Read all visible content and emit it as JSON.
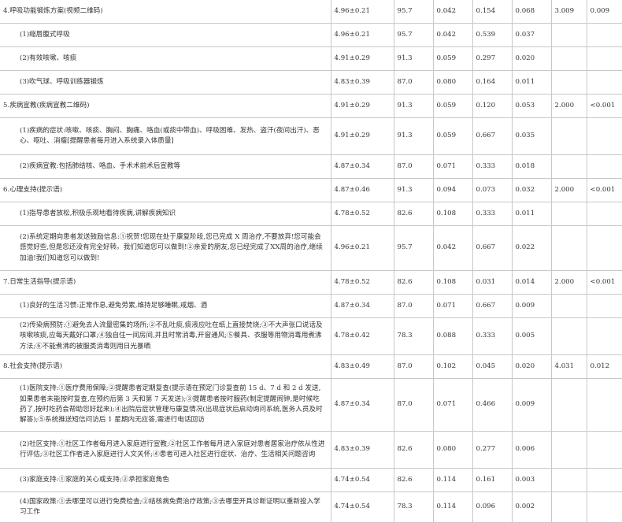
{
  "rows": [
    {
      "item": "4.呼吸功能锻炼方案(视频二维码)",
      "sub": false,
      "h": 1,
      "v": [
        "4.96±0.21",
        "95.7",
        "0.042",
        "0.154",
        "0.068",
        "3.009",
        "0.009"
      ]
    },
    {
      "item": "(1)缩唇腹式呼吸",
      "sub": true,
      "h": 1,
      "v": [
        "4.96±0.21",
        "95.7",
        "0.042",
        "0.539",
        "0.037",
        "",
        ""
      ]
    },
    {
      "item": "(2)有效咳嗽、咳痰",
      "sub": true,
      "h": 1,
      "v": [
        "4.91±0.29",
        "91.3",
        "0.059",
        "0.297",
        "0.020",
        "",
        ""
      ]
    },
    {
      "item": "(3)吹气球、呼吸训练器锻炼",
      "sub": true,
      "h": 1,
      "v": [
        "4.83±0.39",
        "87.0",
        "0.080",
        "0.164",
        "0.011",
        "",
        ""
      ]
    },
    {
      "item": "5.疾病宣教(疾病宣教二维码)",
      "sub": false,
      "h": 1,
      "v": [
        "4.91±0.29",
        "91.3",
        "0.059",
        "0.120",
        "0.053",
        "2.000",
        "<0.001"
      ]
    },
    {
      "item": "(1)疾病的症状:咳嗽、咳痰、胸闷、胸痛、咯血(或痰中带血)、呼吸困难、发热、盗汗(夜间出汗)、恶心、呕吐、消瘦[提醒患者每月进入系统录入体质量]",
      "sub": true,
      "h": 3,
      "v": [
        "4.91±0.29",
        "91.3",
        "0.059",
        "0.667",
        "0.035",
        "",
        ""
      ]
    },
    {
      "item": "(2)疾病宣教:包括肺结核、咯血、手术术前术后宣教等",
      "sub": true,
      "h": 1,
      "v": [
        "4.87±0.34",
        "87.0",
        "0.071",
        "0.333",
        "0.018",
        "",
        ""
      ]
    },
    {
      "item": "6.心理支持(提示语)",
      "sub": false,
      "h": 1,
      "v": [
        "4.87±0.46",
        "91.3",
        "0.094",
        "0.073",
        "0.032",
        "2.000",
        "<0.001"
      ]
    },
    {
      "item": "(1)指导患者放松,积极乐观地看待疾病,讲解疾病知识",
      "sub": true,
      "h": 1,
      "v": [
        "4.78±0.52",
        "82.6",
        "0.108",
        "0.333",
        "0.011",
        "",
        ""
      ]
    },
    {
      "item": "(2)系统定期向患者发送鼓励信息:①祝贺!您现在处于康复阶段,您已完成 X 周治疗,不要放弃!您可能会感觉好些,但是您还没有完全好转。我们知道您可以做到!②亲爱的朋友,您已经完成了XX周的治疗,继续加油!我们知道您可以做到!",
      "sub": true,
      "h": 4,
      "v": [
        "4.96±0.21",
        "95.7",
        "0.042",
        "0.667",
        "0.022",
        "",
        ""
      ]
    },
    {
      "item": "7.日常生活指导(提示语)",
      "sub": false,
      "h": 1,
      "v": [
        "4.78±0.52",
        "82.6",
        "0.108",
        "0.031",
        "0.014",
        "2.000",
        "<0.001"
      ]
    },
    {
      "item": "(1)良好的生活习惯:正常作息,避免劳累,维持足够睡眠,戒烟、酒",
      "sub": true,
      "h": 1,
      "v": [
        "4.87±0.34",
        "87.0",
        "0.071",
        "0.667",
        "0.009",
        "",
        ""
      ]
    },
    {
      "item": "(2)传染病预防:①避免去人流量密集的场所;②不乱吐痰,痰液应吐在纸上直接焚烧;③不大声张口说话及咳嗽咳痰,应每天戴好口罩;④独自住一间房间,并且时常消毒,开窗通风;⑤餐具、衣服等用物消毒用煮沸方法;⑥不能煮沸的被服类消毒则用日光暴晒",
      "sub": true,
      "h": 3,
      "v": [
        "4.78±0.42",
        "78.3",
        "0.088",
        "0.333",
        "0.005",
        "",
        ""
      ]
    },
    {
      "item": "8.社会支持(提示语)",
      "sub": false,
      "h": 1,
      "v": [
        "4.83±0.49",
        "87.0",
        "0.102",
        "0.045",
        "0.020",
        "4.031",
        "0.012"
      ]
    },
    {
      "item": "(1)医院支持:①医疗费用保障;②提醒患者定期复查(提示语在预定门诊复查前 15 d、7 d 和 2 d 发送,如果患者未能按时复查,在预约后第 3 天和第 7 天发送);③提醒患者按时服药(制定提醒闹钟,是时候吃药了,按时吃药会帮助您好起来);④出院后症状管理与康复情况(出现症状后启动询问系统,医务人员及时解答);⑤系统推送短信问访后 1 星期内无应答,需进行电话回访",
      "sub": true,
      "h": 5,
      "v": [
        "4.87±0.34",
        "87.0",
        "0.071",
        "0.466",
        "0.009",
        "",
        ""
      ]
    },
    {
      "item": "(2)社区支持:①社区工作者每月进入家庭进行宣教;②社区工作者每月进入家庭对患者居家治疗依从性进行评估;③社区工作者进入家庭进行人文关怀;④患者可进入社区进行症状、治疗、生活相关问题咨询",
      "sub": true,
      "h": 3,
      "v": [
        "4.83±0.39",
        "82.6",
        "0.080",
        "0.277",
        "0.006",
        "",
        ""
      ]
    },
    {
      "item": "(3)家庭支持:①家庭的关心或支持;②承担家庭角色",
      "sub": true,
      "h": 1,
      "v": [
        "4.74±0.54",
        "82.6",
        "0.114",
        "0.161",
        "0.003",
        "",
        ""
      ]
    },
    {
      "item": "(4)国家政策:①去哪里可以进行免费检查;②结核病免费治疗政策;③去哪里开具诊断证明以重新投入学习工作",
      "sub": true,
      "h": 2,
      "v": [
        "4.74±0.54",
        "78.3",
        "0.114",
        "0.096",
        "0.002",
        "",
        ""
      ]
    }
  ]
}
